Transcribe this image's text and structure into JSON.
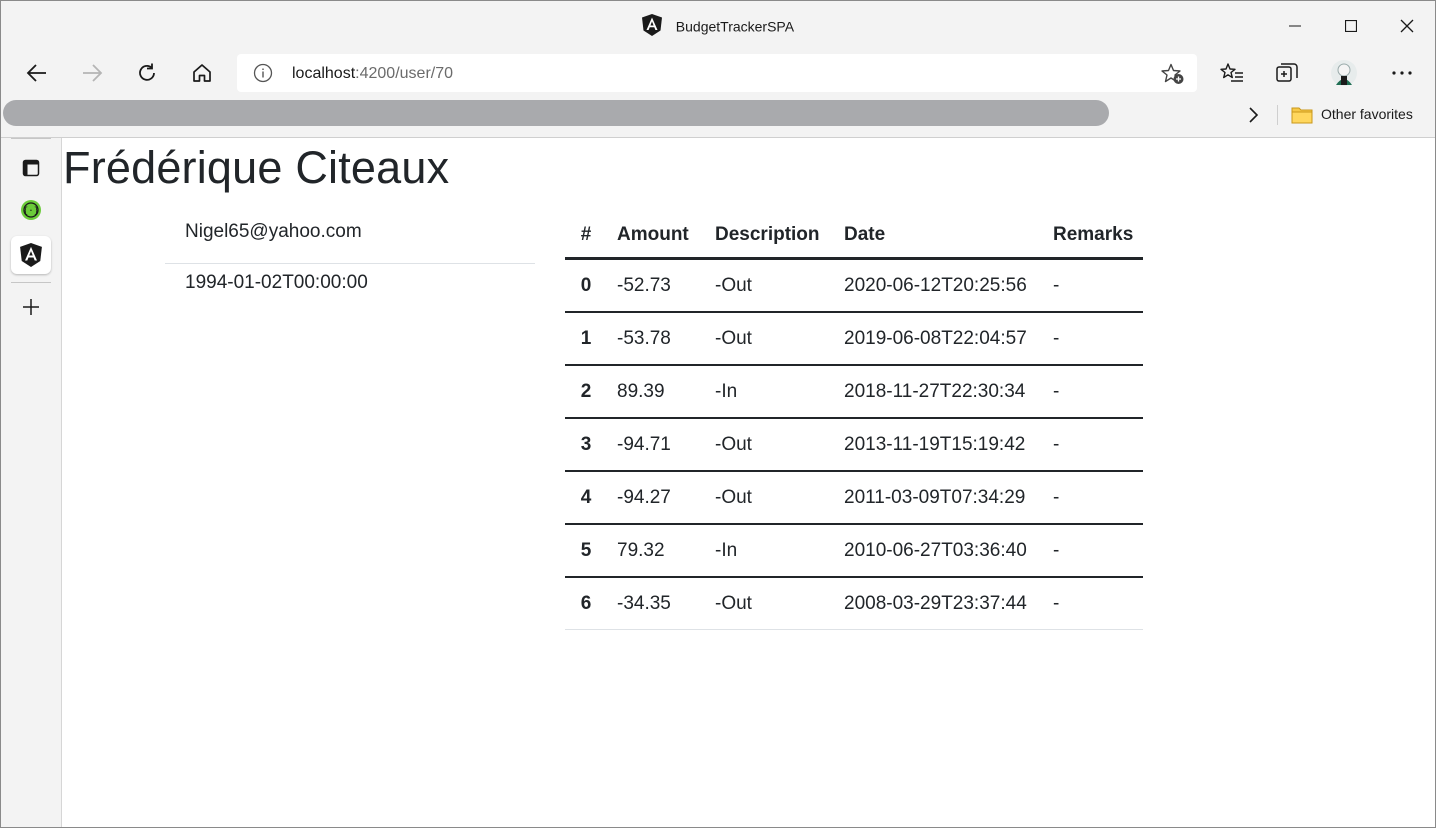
{
  "window": {
    "title": "BudgetTrackerSPA"
  },
  "address_bar": {
    "host": "localhost",
    "path": ":4200/user/70"
  },
  "favorites": {
    "other_label": "Other favorites"
  },
  "user": {
    "name": "Frédérique Citeaux",
    "email": "Nigel65@yahoo.com",
    "birth": "1994-01-02T00:00:00"
  },
  "table": {
    "headers": [
      "#",
      "Amount",
      "Description",
      "Date",
      "Remarks"
    ],
    "rows": [
      {
        "idx": "0",
        "amount": "-52.73",
        "description": "-Out",
        "date": "2020-06-12T20:25:56",
        "remarks": "-"
      },
      {
        "idx": "1",
        "amount": "-53.78",
        "description": "-Out",
        "date": "2019-06-08T22:04:57",
        "remarks": "-"
      },
      {
        "idx": "2",
        "amount": "89.39",
        "description": "-In",
        "date": "2018-11-27T22:30:34",
        "remarks": "-"
      },
      {
        "idx": "3",
        "amount": "-94.71",
        "description": "-Out",
        "date": "2013-11-19T15:19:42",
        "remarks": "-"
      },
      {
        "idx": "4",
        "amount": "-94.27",
        "description": "-Out",
        "date": "2011-03-09T07:34:29",
        "remarks": "-"
      },
      {
        "idx": "5",
        "amount": "79.32",
        "description": "-In",
        "date": "2010-06-27T03:36:40",
        "remarks": "-"
      },
      {
        "idx": "6",
        "amount": "-34.35",
        "description": "-Out",
        "date": "2008-03-29T23:37:44",
        "remarks": "-"
      }
    ]
  },
  "icons": {
    "back": "back-arrow-icon",
    "forward": "forward-arrow-icon",
    "refresh": "refresh-icon",
    "home": "home-icon",
    "info": "info-icon",
    "add_favorite": "star-plus-icon",
    "favorites": "favorites-icon",
    "collections": "collections-icon",
    "profile": "avatar",
    "more": "more-icon"
  },
  "colors": {
    "chrome": "#f3f3f3",
    "text": "#212529",
    "angular": "#1a1a1a"
  }
}
